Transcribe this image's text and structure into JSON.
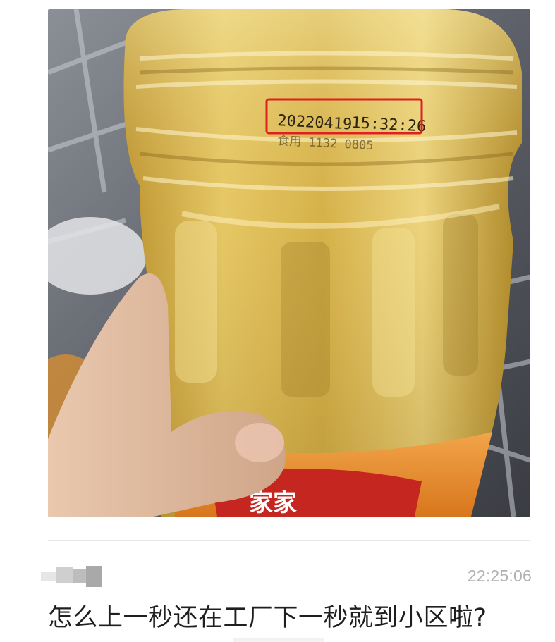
{
  "photo": {
    "print_date": "20220419",
    "print_time": "15:32:26",
    "print_second_line": "食用   1132  0805",
    "brand_mark": "家家",
    "highlight_color": "#e02020",
    "oil_color": "#d9b54a",
    "label_color": "#e8902e"
  },
  "post": {
    "timestamp": "22:25:06",
    "caption": "怎么上一秒还在工厂下一秒就到小区啦?"
  }
}
